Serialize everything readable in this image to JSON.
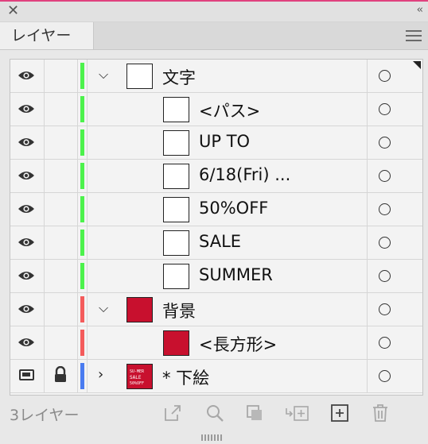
{
  "panel": {
    "tab_label": "レイヤー",
    "layer_count": "3レイヤー"
  },
  "colors": {
    "text_layer": "#4cf24c",
    "bg_layer": "#f45b5b",
    "sketch_layer": "#4a7bf0",
    "thumb_red": "#c8102e"
  },
  "rows": [
    {
      "label": "文字",
      "level": "layer",
      "expanded": true,
      "color": "green",
      "thumb": "white"
    },
    {
      "label": "<パス>",
      "level": "item",
      "color": "green",
      "thumb": "white"
    },
    {
      "label": "UP TO",
      "level": "item",
      "color": "green",
      "thumb": "white"
    },
    {
      "label": "6/18(Fri) ...",
      "level": "item",
      "color": "green",
      "thumb": "white"
    },
    {
      "label": "50%OFF",
      "level": "item",
      "color": "green",
      "thumb": "white"
    },
    {
      "label": "SALE",
      "level": "item",
      "color": "green",
      "thumb": "white"
    },
    {
      "label": "SUMMER",
      "level": "item",
      "color": "green",
      "thumb": "white"
    },
    {
      "label": "背景",
      "level": "layer",
      "expanded": true,
      "color": "red",
      "thumb": "red"
    },
    {
      "label": "<長方形>",
      "level": "item",
      "color": "red",
      "thumb": "red"
    },
    {
      "label": "* 下絵",
      "level": "layer",
      "expanded": false,
      "color": "blue",
      "thumb": "artwork",
      "locked": true,
      "template": true
    }
  ],
  "footer_icons": [
    "export-icon",
    "search-icon",
    "clipping-mask-icon",
    "move-to-layer-icon",
    "new-sublayer-icon",
    "delete-icon"
  ]
}
